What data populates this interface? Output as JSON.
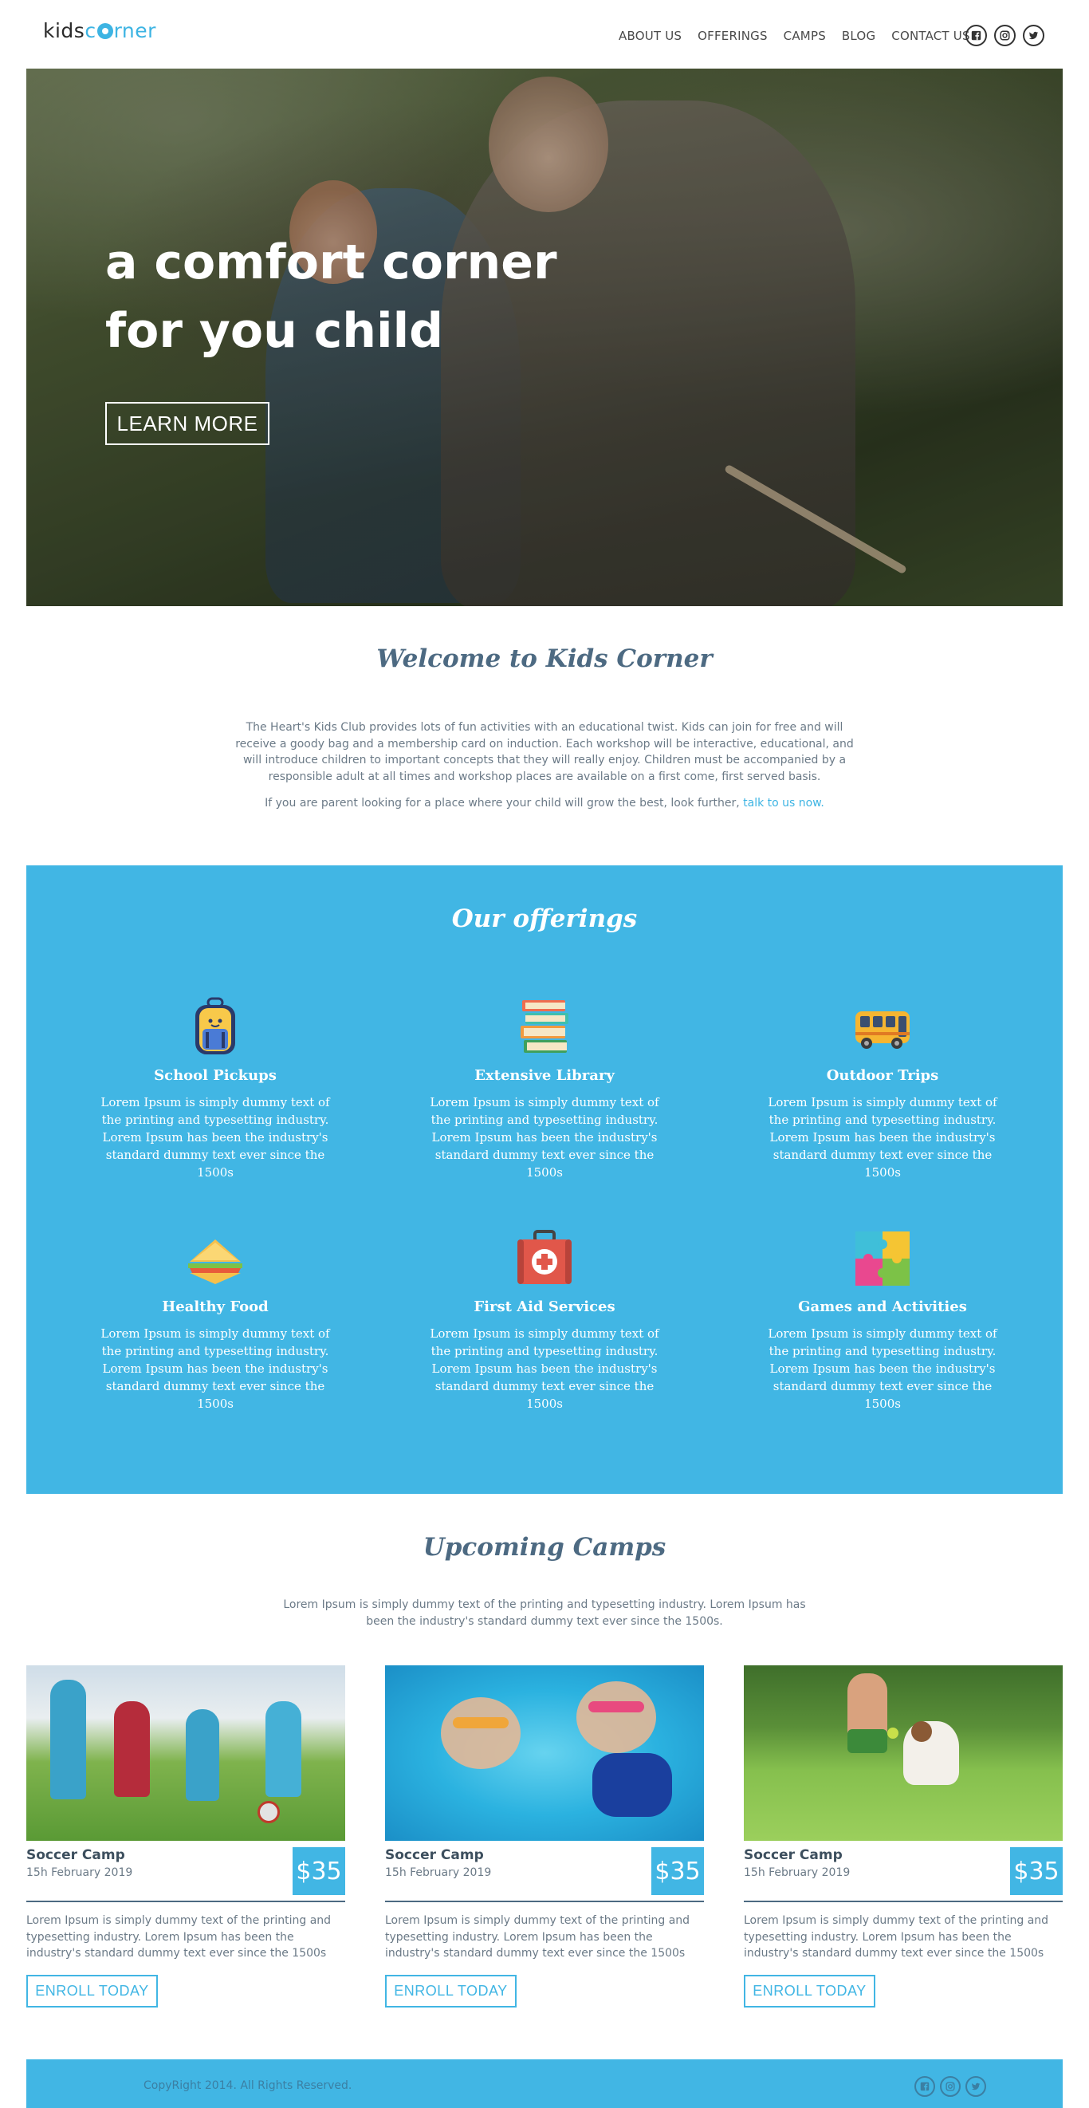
{
  "header": {
    "logo": "kidscorner",
    "nav": [
      "ABOUT US",
      "OFFERINGS",
      "CAMPS",
      "BLOG",
      "CONTACT US"
    ],
    "social": [
      "facebook-icon",
      "instagram-icon",
      "twitter-icon"
    ]
  },
  "hero": {
    "headline_line1": "a comfort corner",
    "headline_line2": "for you child",
    "button": "LEARN MORE"
  },
  "welcome": {
    "title": "Welcome to Kids Corner",
    "body": "The Heart's Kids Club provides lots of fun activities with an educational twist. Kids can join for free and will receive a goody bag and a membership card on induction. Each workshop will be interactive, educational, and will introduce children to important concepts that they will really enjoy. Children must be accompanied by a responsible adult at all times and workshop places are available on a first come, first served basis.",
    "cta_text": "If you are parent looking for a place where your child will grow the best, look further,",
    "cta_link": "talk to us now."
  },
  "offerings": {
    "title": "Our offerings",
    "items": [
      {
        "icon": "backpack-icon",
        "title": "School Pickups",
        "text": "Lorem Ipsum is simply dummy text of the printing and typesetting industry. Lorem Ipsum has been the industry's standard dummy text ever since the 1500s"
      },
      {
        "icon": "books-icon",
        "title": "Extensive Library",
        "text": "Lorem Ipsum is simply dummy text of the printing and typesetting industry. Lorem Ipsum has been the industry's standard dummy text ever since the 1500s"
      },
      {
        "icon": "bus-icon",
        "title": "Outdoor Trips",
        "text": "Lorem Ipsum is simply dummy text of the printing and typesetting industry. Lorem Ipsum has been the industry's standard dummy text ever since the 1500s"
      },
      {
        "icon": "sandwich-icon",
        "title": "Healthy Food",
        "text": "Lorem Ipsum is simply dummy text of the printing and typesetting industry. Lorem Ipsum has been the industry's standard dummy text ever since the 1500s"
      },
      {
        "icon": "first-aid-kit-icon",
        "title": "First Aid Services",
        "text": "Lorem Ipsum is simply dummy text of the printing and typesetting industry. Lorem Ipsum has been the industry's standard dummy text ever since the 1500s"
      },
      {
        "icon": "puzzle-icon",
        "title": "Games and Activities",
        "text": "Lorem Ipsum is simply dummy text of the printing and typesetting industry. Lorem Ipsum has been the industry's standard dummy text ever since the 1500s"
      }
    ]
  },
  "camps": {
    "title": "Upcoming Camps",
    "subtitle": "Lorem Ipsum is simply dummy text of the printing and typesetting industry. Lorem Ipsum has been the industry's standard dummy text ever since the 1500s.",
    "cards": [
      {
        "title": "Soccer Camp",
        "date": "15h February 2019",
        "price": "$35",
        "text": "Lorem Ipsum is simply dummy text of the printing and typesetting industry. Lorem Ipsum has been the industry's standard dummy text ever since the 1500s",
        "button": "ENROLL TODAY"
      },
      {
        "title": "Soccer Camp",
        "date": "15h February 2019",
        "price": "$35",
        "text": "Lorem Ipsum is simply dummy text of the printing and typesetting industry. Lorem Ipsum has been the industry's standard dummy text ever since the 1500s",
        "button": "ENROLL TODAY"
      },
      {
        "title": "Soccer Camp",
        "date": "15h February 2019",
        "price": "$35",
        "text": "Lorem Ipsum is simply dummy text of the printing and typesetting industry. Lorem Ipsum has been the industry's standard dummy text ever since the 1500s",
        "button": "ENROLL TODAY"
      }
    ]
  },
  "footer": {
    "copyright": "CopyRight 2014. All Rights Reserved."
  },
  "colors": {
    "accent": "#41b6e4",
    "heading": "#4d6a82",
    "text": "#6b7a87"
  }
}
